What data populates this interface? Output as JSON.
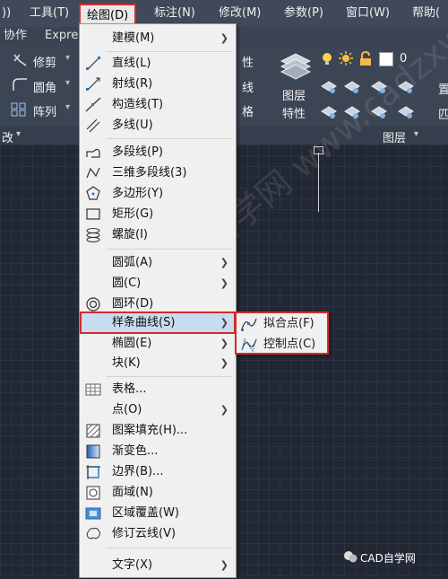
{
  "menubar": {
    "items": [
      "))",
      "工具(T)",
      "绘图(D)",
      "标注(N)",
      "修改(M)",
      "参数(P)",
      "窗口(W)",
      "帮助("
    ],
    "active": "绘图(D)"
  },
  "tabs": [
    "协作",
    "Expres"
  ],
  "ribbon": {
    "modify": [
      "修剪",
      "圆角",
      "阵列"
    ],
    "right_fragments": [
      "性",
      "线",
      "格"
    ],
    "layer_properties_line1": "图层",
    "layer_properties_line2": "特性",
    "layer_value": "0",
    "layer_right": [
      "置",
      "匹"
    ],
    "footer_left": "改",
    "footer_layer": "图层"
  },
  "draw_menu": {
    "items": [
      {
        "label": "建模(M)",
        "icon": "modeling-icon",
        "submenu": true
      },
      {
        "label": "直线(L)",
        "icon": "line-icon"
      },
      {
        "label": "射线(R)",
        "icon": "ray-icon"
      },
      {
        "label": "构造线(T)",
        "icon": "construction-line-icon"
      },
      {
        "label": "多线(U)",
        "icon": "multiline-icon"
      },
      {
        "label": "多段线(P)",
        "icon": "polyline-icon"
      },
      {
        "label": "三维多段线(3)",
        "icon": "3d-polyline-icon"
      },
      {
        "label": "多边形(Y)",
        "icon": "polygon-icon"
      },
      {
        "label": "矩形(G)",
        "icon": "rectangle-icon"
      },
      {
        "label": "螺旋(I)",
        "icon": "helix-icon"
      },
      {
        "label": "圆弧(A)",
        "icon": "arc-icon",
        "submenu": true
      },
      {
        "label": "圆(C)",
        "icon": "circle-icon",
        "submenu": true
      },
      {
        "label": "圆环(D)",
        "icon": "donut-icon"
      },
      {
        "label": "样条曲线(S)",
        "icon": "spline-icon",
        "submenu": true
      },
      {
        "label": "椭圆(E)",
        "icon": "ellipse-icon",
        "submenu": true
      },
      {
        "label": "块(K)",
        "icon": "block-icon",
        "submenu": true
      },
      {
        "label": "表格...",
        "icon": "table-icon"
      },
      {
        "label": "点(O)",
        "icon": "point-icon",
        "submenu": true
      },
      {
        "label": "图案填充(H)...",
        "icon": "hatch-icon"
      },
      {
        "label": "渐变色...",
        "icon": "gradient-icon"
      },
      {
        "label": "边界(B)...",
        "icon": "boundary-icon"
      },
      {
        "label": "面域(N)",
        "icon": "region-icon"
      },
      {
        "label": "区域覆盖(W)",
        "icon": "wipeout-icon"
      },
      {
        "label": "修订云线(V)",
        "icon": "revcloud-icon"
      },
      {
        "label": "文字(X)",
        "icon": "text-icon",
        "submenu": true
      }
    ]
  },
  "spline_submenu": {
    "items": [
      {
        "label": "拟合点(F)",
        "icon": "fit-points-icon"
      },
      {
        "label": "控制点(C)",
        "icon": "control-vertices-icon"
      }
    ]
  },
  "watermark": "CAD自学网 www.cadzxw.com",
  "brand": "CAD自学网",
  "colors": {
    "highlight_border": "#d42a2a",
    "menu_bg": "#f0f0f0",
    "canvas_bg": "#222833"
  }
}
